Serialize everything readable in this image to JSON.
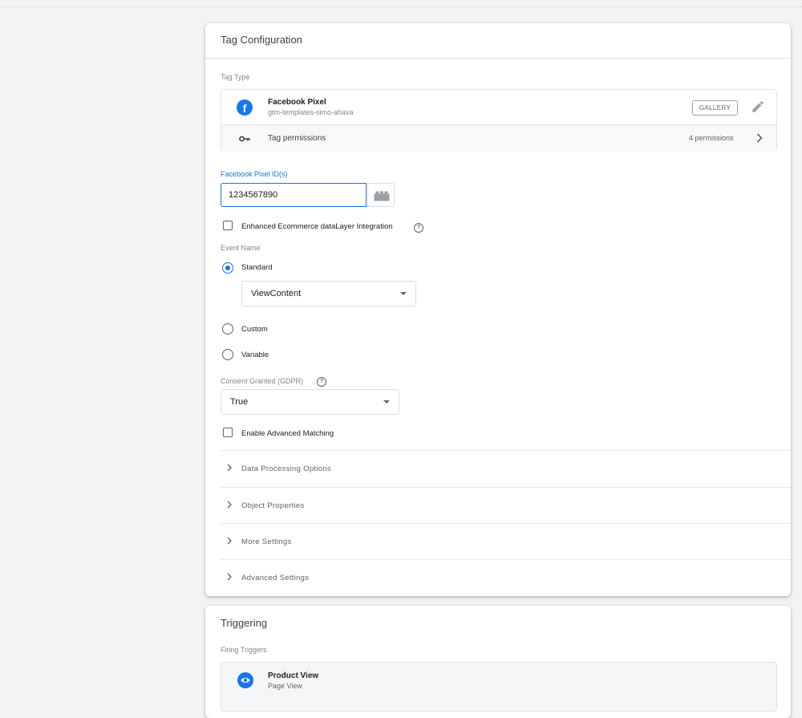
{
  "tag_config": {
    "title": "Tag Configuration",
    "tag_type_label": "Tag Type",
    "template": {
      "name": "Facebook Pixel",
      "source": "gtm-templates-simo-ahava",
      "gallery_label": "GALLERY",
      "icon_letter": "f"
    },
    "permissions": {
      "label": "Tag permissions",
      "count": "4 permissions"
    },
    "pixel_id": {
      "label": "Facebook Pixel ID(s)",
      "value": "1234567890"
    },
    "enhanced_ecommerce": {
      "label": "Enhanced Ecommerce dataLayer Integration",
      "checked": false
    },
    "event_name": {
      "label": "Event Name",
      "options": [
        {
          "label": "Standard",
          "checked": true
        },
        {
          "label": "Custom",
          "checked": false
        },
        {
          "label": "Variable",
          "checked": false
        }
      ],
      "standard_selected": "ViewContent"
    },
    "consent": {
      "label": "Consent Granted (GDPR)",
      "selected": "True"
    },
    "advanced_matching": {
      "label": "Enable Advanced Matching",
      "checked": false
    },
    "sections": [
      {
        "label": "Data Processing Options"
      },
      {
        "label": "Object Properties"
      },
      {
        "label": "More Settings"
      },
      {
        "label": "Advanced Settings"
      }
    ],
    "help_glyph": "?"
  },
  "triggering": {
    "title": "Triggering",
    "firing_label": "Firing Triggers",
    "trigger": {
      "name": "Product View",
      "type": "Page View"
    }
  },
  "colors": {
    "accent": "#1a73e8",
    "facebook": "#1877f2",
    "background": "#f1f3f4"
  }
}
